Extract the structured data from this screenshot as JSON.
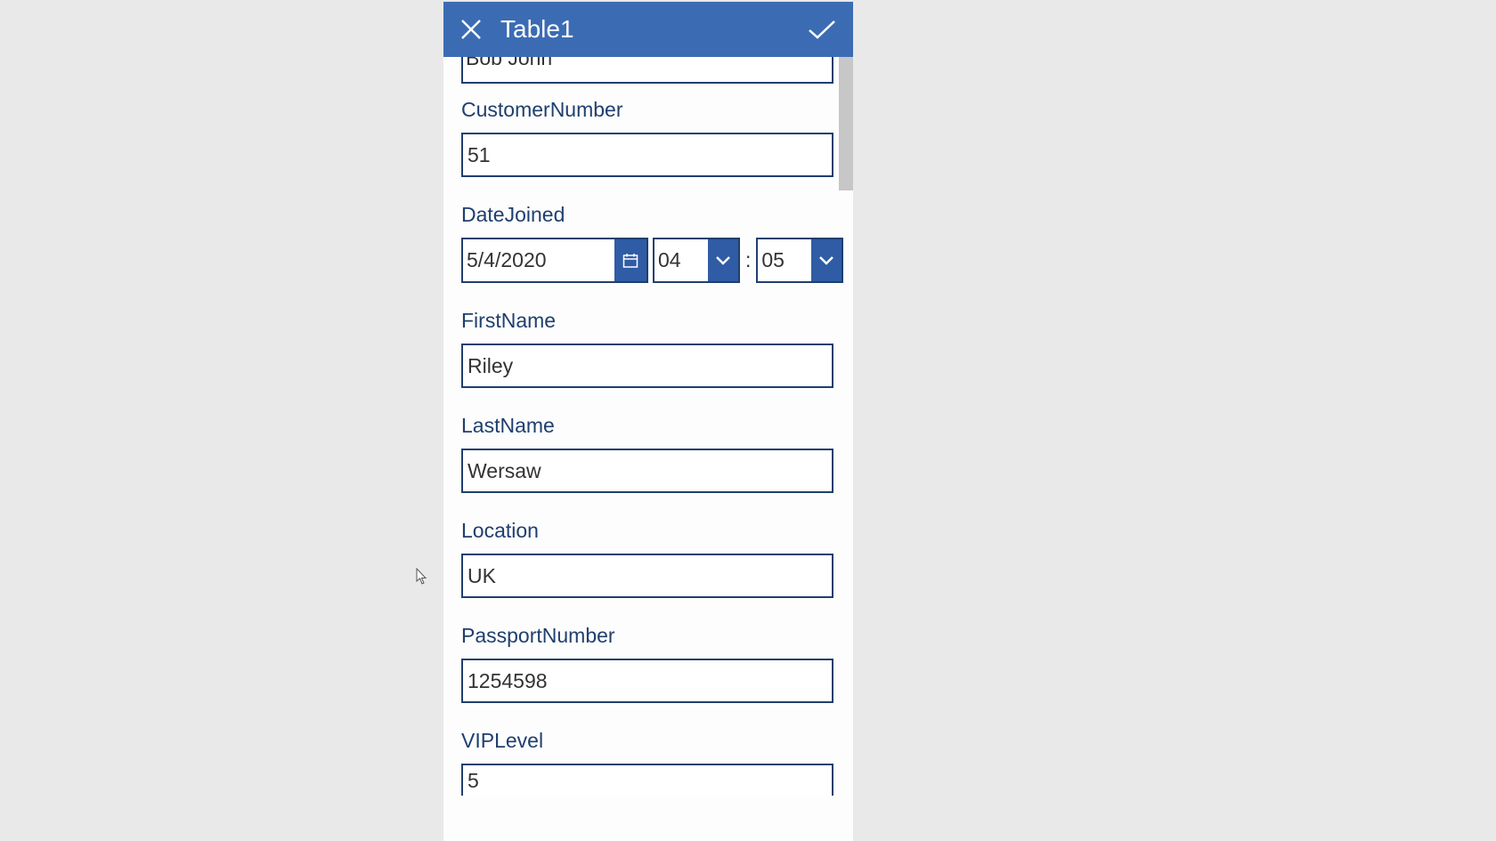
{
  "header": {
    "title": "Table1"
  },
  "form": {
    "topField": {
      "value": "Bob John"
    },
    "customerNumber": {
      "label": "CustomerNumber",
      "value": "51"
    },
    "dateJoined": {
      "label": "DateJoined",
      "date": "5/4/2020",
      "hour": "04",
      "minute": "05"
    },
    "firstName": {
      "label": "FirstName",
      "value": "Riley"
    },
    "lastName": {
      "label": "LastName",
      "value": "Wersaw"
    },
    "location": {
      "label": "Location",
      "value": "UK"
    },
    "passportNumber": {
      "label": "PassportNumber",
      "value": "1254598"
    },
    "vipLevel": {
      "label": "VIPLevel",
      "value": "5"
    }
  }
}
